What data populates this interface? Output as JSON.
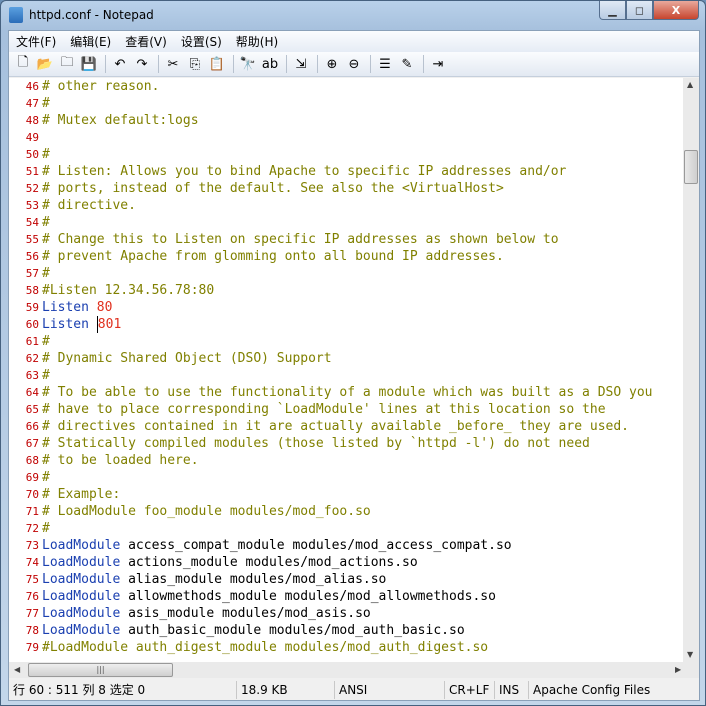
{
  "window": {
    "title": "httpd.conf - Notepad",
    "minimize": "▁",
    "maximize": "◻",
    "close": "X"
  },
  "menu": [
    "文件(F)",
    "编辑(E)",
    "查看(V)",
    "设置(S)",
    "帮助(H)"
  ],
  "toolbar": [
    {
      "name": "new-icon",
      "g": "🗋"
    },
    {
      "name": "open-icon",
      "g": "📂"
    },
    {
      "name": "find-file-icon",
      "g": "🗀"
    },
    {
      "name": "save-icon",
      "g": "💾"
    },
    {
      "sep": true
    },
    {
      "name": "undo-icon",
      "g": "↶"
    },
    {
      "name": "redo-icon",
      "g": "↷"
    },
    {
      "sep": true
    },
    {
      "name": "cut-icon",
      "g": "✂"
    },
    {
      "name": "copy-icon",
      "g": "⎘"
    },
    {
      "name": "paste-icon",
      "g": "📋"
    },
    {
      "sep": true
    },
    {
      "name": "find-icon",
      "g": "🔭"
    },
    {
      "name": "replace-icon",
      "g": "ab"
    },
    {
      "sep": true
    },
    {
      "name": "goto-icon",
      "g": "⇲"
    },
    {
      "sep": true
    },
    {
      "name": "zoom-in-icon",
      "g": "⊕"
    },
    {
      "name": "zoom-out-icon",
      "g": "⊖"
    },
    {
      "sep": true
    },
    {
      "name": "wordwrap-icon",
      "g": "☰"
    },
    {
      "name": "scheme-icon",
      "g": "✎"
    },
    {
      "sep": true
    },
    {
      "name": "exit-icon",
      "g": "⇥"
    }
  ],
  "colors": {
    "comment": "#808000",
    "keyword": "#1a3fb0",
    "number": "#e0301e",
    "line_number": "#c00000"
  },
  "lines": [
    {
      "n": "46",
      "s": [
        [
          "# other reason.",
          "comment"
        ]
      ]
    },
    {
      "n": "47",
      "s": [
        [
          "#",
          "comment"
        ]
      ]
    },
    {
      "n": "48",
      "s": [
        [
          "# Mutex default:logs",
          "comment"
        ]
      ]
    },
    {
      "n": "49",
      "s": []
    },
    {
      "n": "50",
      "s": [
        [
          "#",
          "comment"
        ]
      ]
    },
    {
      "n": "51",
      "s": [
        [
          "# Listen: Allows you to bind Apache to specific IP addresses and/or",
          "comment"
        ]
      ]
    },
    {
      "n": "52",
      "s": [
        [
          "# ports, instead of the default. See also the <VirtualHost>",
          "comment"
        ]
      ]
    },
    {
      "n": "53",
      "s": [
        [
          "# directive.",
          "comment"
        ]
      ]
    },
    {
      "n": "54",
      "s": [
        [
          "#",
          "comment"
        ]
      ]
    },
    {
      "n": "55",
      "s": [
        [
          "# Change this to Listen on specific IP addresses as shown below to",
          "comment"
        ]
      ]
    },
    {
      "n": "56",
      "s": [
        [
          "# prevent Apache from glomming onto all bound IP addresses.",
          "comment"
        ]
      ]
    },
    {
      "n": "57",
      "s": [
        [
          "#",
          "comment"
        ]
      ]
    },
    {
      "n": "58",
      "s": [
        [
          "#Listen 12.34.56.78:80",
          "comment"
        ]
      ]
    },
    {
      "n": "59",
      "s": [
        [
          "Listen ",
          "kw"
        ],
        [
          "80",
          "num"
        ]
      ]
    },
    {
      "n": "60",
      "s": [
        [
          "Listen ",
          "kw"
        ],
        [
          "801",
          "num caret"
        ]
      ]
    },
    {
      "n": "61",
      "s": [
        [
          "#",
          "comment"
        ]
      ]
    },
    {
      "n": "62",
      "s": [
        [
          "# Dynamic Shared Object (DSO) Support",
          "comment"
        ]
      ]
    },
    {
      "n": "63",
      "s": [
        [
          "#",
          "comment"
        ]
      ]
    },
    {
      "n": "64",
      "s": [
        [
          "# To be able to use the functionality of a module which was built as a DSO you",
          "comment"
        ]
      ]
    },
    {
      "n": "65",
      "s": [
        [
          "# have to place corresponding `LoadModule' lines at this location so the",
          "comment"
        ]
      ]
    },
    {
      "n": "66",
      "s": [
        [
          "# directives contained in it are actually available _before_ they are used.",
          "comment"
        ]
      ]
    },
    {
      "n": "67",
      "s": [
        [
          "# Statically compiled modules (those listed by `httpd -l') do not need",
          "comment"
        ]
      ]
    },
    {
      "n": "68",
      "s": [
        [
          "# to be loaded here.",
          "comment"
        ]
      ]
    },
    {
      "n": "69",
      "s": [
        [
          "#",
          "comment"
        ]
      ]
    },
    {
      "n": "70",
      "s": [
        [
          "# Example:",
          "comment"
        ]
      ]
    },
    {
      "n": "71",
      "s": [
        [
          "# LoadModule foo_module modules/mod_foo.so",
          "comment"
        ]
      ]
    },
    {
      "n": "72",
      "s": [
        [
          "#",
          "comment"
        ]
      ]
    },
    {
      "n": "73",
      "s": [
        [
          "LoadModule ",
          "kw"
        ],
        [
          "access_compat_module modules/mod_access_compat.so",
          "plain"
        ]
      ]
    },
    {
      "n": "74",
      "s": [
        [
          "LoadModule ",
          "kw"
        ],
        [
          "actions_module modules/mod_actions.so",
          "plain"
        ]
      ]
    },
    {
      "n": "75",
      "s": [
        [
          "LoadModule ",
          "kw"
        ],
        [
          "alias_module modules/mod_alias.so",
          "plain"
        ]
      ]
    },
    {
      "n": "76",
      "s": [
        [
          "LoadModule ",
          "kw"
        ],
        [
          "allowmethods_module modules/mod_allowmethods.so",
          "plain"
        ]
      ]
    },
    {
      "n": "77",
      "s": [
        [
          "LoadModule ",
          "kw"
        ],
        [
          "asis_module modules/mod_asis.so",
          "plain"
        ]
      ]
    },
    {
      "n": "78",
      "s": [
        [
          "LoadModule ",
          "kw"
        ],
        [
          "auth_basic_module modules/mod_auth_basic.so",
          "plain"
        ]
      ]
    },
    {
      "n": "79",
      "s": [
        [
          "#LoadModule auth_digest_module modules/mod_auth_digest.so",
          "comment"
        ]
      ]
    }
  ],
  "status": {
    "position": "行 60 : 511   列 8   选定 0",
    "size": "18.9 KB",
    "encoding": "ANSI",
    "eol": "CR+LF",
    "mode": "INS",
    "scheme": "Apache Config Files"
  }
}
